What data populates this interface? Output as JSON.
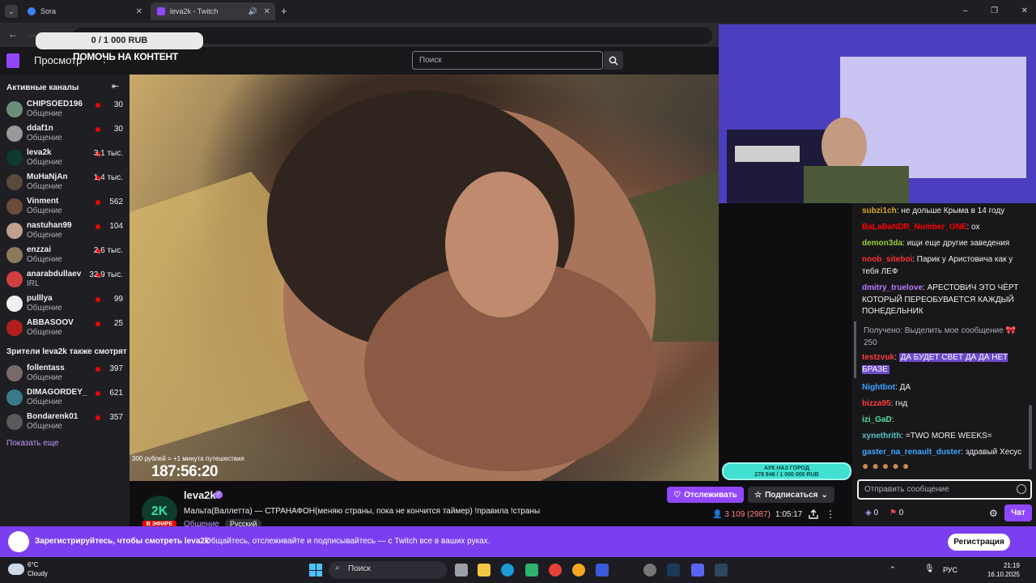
{
  "browser": {
    "tabs": [
      {
        "label": "Sora",
        "favicon_color": "#3b82f6"
      },
      {
        "label": "leva2k - Twitch",
        "favicon_color": "#9147ff"
      }
    ],
    "new_tab": "+"
  },
  "donation": {
    "amount": "0 / 1 000 RUB",
    "title": "ПОМОЧЬ НА КОНТЕНТ"
  },
  "topbar": {
    "browse": "Просмотр",
    "search_placeholder": "Поиск"
  },
  "sidebar": {
    "active_heading": "Активные каналы",
    "channels": [
      {
        "name": "CHIPSOED196",
        "category": "Общение",
        "viewers": "30",
        "avatar": "#6b8e7a"
      },
      {
        "name": "ddaf1n",
        "category": "Общение",
        "viewers": "30",
        "avatar": "#999999"
      },
      {
        "name": "leva2k",
        "category": "Общение",
        "viewers": "3,1 тыс.",
        "avatar": "#0d3b2e"
      },
      {
        "name": "MuHaNjAn",
        "category": "Общение",
        "viewers": "1,4 тыс.",
        "avatar": "#5a4a3a"
      },
      {
        "name": "Vinment",
        "category": "Общение",
        "viewers": "562",
        "avatar": "#6a4a3a"
      },
      {
        "name": "nastuhan99",
        "category": "Общение",
        "viewers": "104",
        "avatar": "#c0a090"
      },
      {
        "name": "enzzai",
        "category": "Общение",
        "viewers": "2,6 тыс.",
        "avatar": "#8a7a5a"
      },
      {
        "name": "anarabdullaev",
        "category": "IRL",
        "viewers": "32,9 тыс.",
        "avatar": "#d04040"
      },
      {
        "name": "pulllya",
        "category": "Общение",
        "viewers": "99",
        "avatar": "#f0f0f0"
      },
      {
        "name": "ABBASOOV",
        "category": "Общение",
        "viewers": "25",
        "avatar": "#b02020"
      }
    ],
    "also_heading": "Зрители leva2k также смотрят",
    "also": [
      {
        "name": "follentass",
        "category": "Общение",
        "viewers": "397",
        "avatar": "#7a6a6a"
      },
      {
        "name": "DIMAGORDEY_",
        "category": "Общение",
        "viewers": "621",
        "avatar": "#3a7a8a"
      },
      {
        "name": "Bondarenk01",
        "category": "Общение",
        "viewers": "357",
        "avatar": "#5a5a5a"
      }
    ],
    "show_more": "Показать еще"
  },
  "video": {
    "timer_note": "300 рублей = +1 минута путешествия",
    "timer": "187:56:20",
    "auk_line1": "АУК НАЗ ГОРОД",
    "auk_line2": "278 846 / 1 000 000 RUB"
  },
  "stream": {
    "avatar_text": "2K",
    "live_badge": "В ЭФИРЕ",
    "streamer": "leva2k",
    "title": "Мальта(Валлетта) — СТРАНАФОН(меняю страны, пока не кончится таймер) !правила !страны",
    "category": "Общение",
    "tag": "Русский",
    "follow": "Отслеживать",
    "subscribe": "Подписаться",
    "viewers": "3 109 (2987)",
    "uptime": "1:05:17"
  },
  "chat": {
    "messages": [
      {
        "user": "subzi1ch",
        "color": "#daa520",
        "text": "не дольше Крыма в 14 году"
      },
      {
        "user": "BaLaBaNDR_Number_ONE",
        "color": "#ff0000",
        "text": "ох"
      },
      {
        "user": "demon3da",
        "color": "#9acd32",
        "text": "ищи еще другие заведения"
      },
      {
        "user": "noob_siteboi",
        "color": "#ff3030",
        "text": "Парик у Аристовича как у тебя ЛЕФ"
      },
      {
        "user": "dmitry_truelove",
        "color": "#b87aff",
        "text": "АРЕСТОВИЧ ЭТО ЧЁРТ КОТОРЫЙ ПЕРЕОБУВАЕТСЯ КАЖДЫЙ ПОНЕДЕЛЬНИК"
      },
      {
        "user": "testzvuk",
        "color": "#ff3b3b",
        "text": "ДА БУДЕТ СВЕТ ДА ДА НЕТ БРАЗЕ"
      },
      {
        "user": "Nightbot",
        "color": "#3ea6ff",
        "text": "ДА"
      },
      {
        "user": "bizza95",
        "color": "#ff3b3b",
        "text": "гнд"
      },
      {
        "user": "izi_GaD",
        "color": "#56e39f",
        "text": ""
      },
      {
        "user": "xynethrith",
        "color": "#56c2c6",
        "text": "=TWO MORE WEEKS="
      },
      {
        "user": "gaster_na_renault_duster",
        "color": "#3ea6ff",
        "text": "здравый Хесус"
      }
    ],
    "redeem_label": "Получено: Выделить мое сообщение",
    "redeem_cost": "250",
    "input_placeholder": "Отправить сообщение",
    "points_a": "0",
    "points_b": "0",
    "chat_button": "Чат"
  },
  "banner": {
    "bold": "Зарегистрируйтесь, чтобы смотреть leva2k",
    "text": "Общайтесь, отслеживайте и подписывайтесь — с Twitch все в ваших руках.",
    "button": "Регистрация"
  },
  "taskbar": {
    "temp": "6°C",
    "condition": "Cloudy",
    "search": "Поиск",
    "lang": "РУС",
    "time": "21:19",
    "date": "16.10.2025"
  }
}
